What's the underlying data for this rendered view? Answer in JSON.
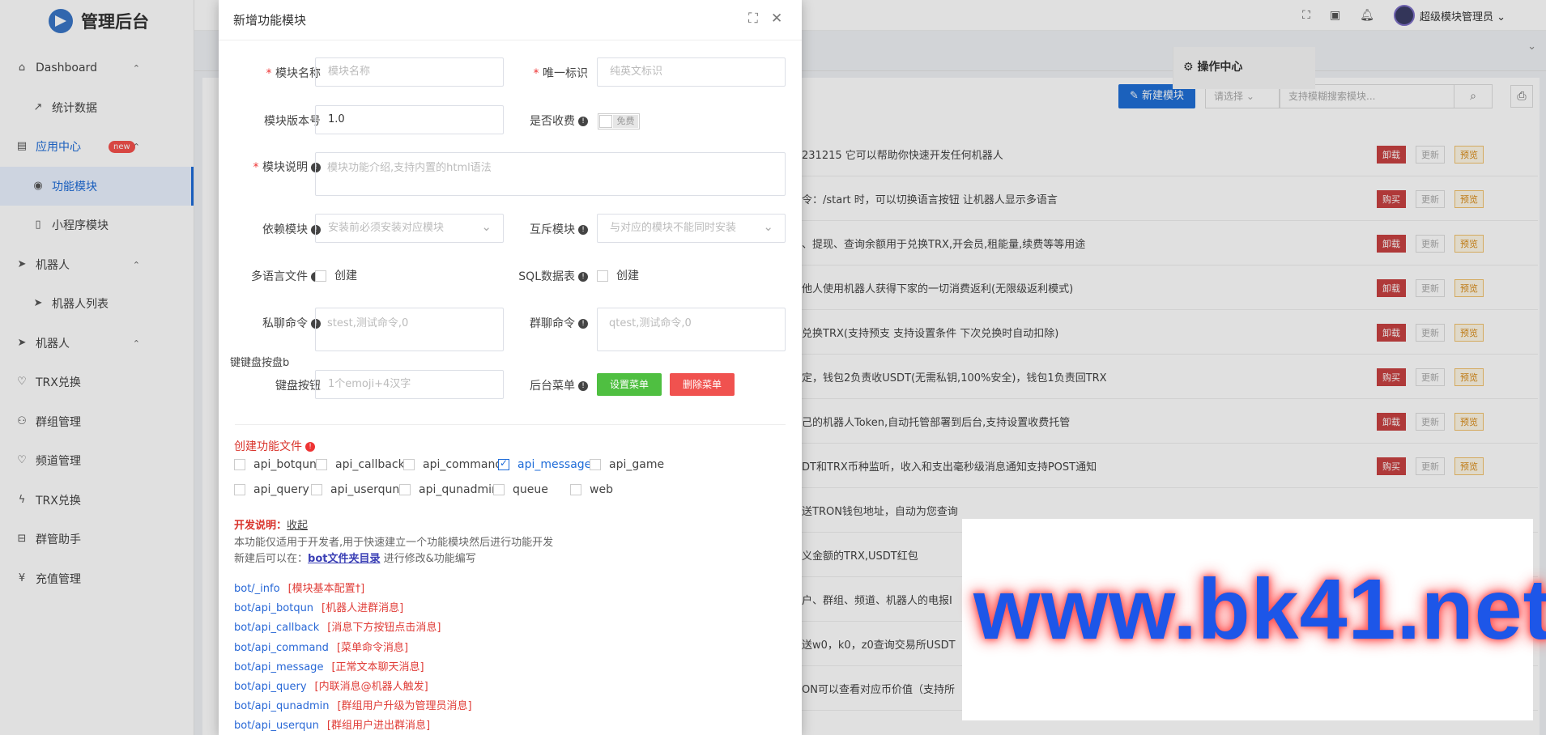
{
  "app": {
    "title": "管理后台"
  },
  "sidebar": {
    "items": [
      {
        "label": "Dashboard",
        "icon": "home-icon",
        "arrow": true
      },
      {
        "label": "统计数据",
        "icon": "trend-icon",
        "sub": true
      },
      {
        "label": "应用中心",
        "icon": "app-center-icon",
        "badge": "new",
        "arrow": true,
        "open": true
      },
      {
        "label": "功能模块",
        "icon": "toggle-icon",
        "sub": true,
        "active": true
      },
      {
        "label": "小程序模块",
        "icon": "doc-icon",
        "sub": true
      },
      {
        "label": "机器人",
        "icon": "send-icon",
        "arrow": true
      },
      {
        "label": "机器人列表",
        "icon": "send-icon",
        "sub": true
      },
      {
        "label": "机器人",
        "icon": "send-icon",
        "arrow": true
      },
      {
        "label": "TRX兑换",
        "icon": "heart-icon"
      },
      {
        "label": "群组管理",
        "icon": "user-icon"
      },
      {
        "label": "频道管理",
        "icon": "heart-icon"
      },
      {
        "label": "TRX兑换",
        "icon": "bolt-icon"
      },
      {
        "label": "群管助手",
        "icon": "tool-icon"
      },
      {
        "label": "充值管理",
        "icon": "yen-icon"
      }
    ]
  },
  "topbar": {
    "user": "超级模块管理员"
  },
  "list": {
    "new_button": "新建模块",
    "select_placeholder": "请选择",
    "search_placeholder": "支持模糊搜索模块...",
    "ops_header": "操作中心",
    "rows": [
      {
        "desc": "231215 它可以帮助你快速开发任何机器人",
        "a": "卸载",
        "b": "更新",
        "c": "预览"
      },
      {
        "desc": "令：/start 时，可以切换语言按钮 让机器人显示多语言",
        "a": "购买",
        "b": "更新",
        "c": "预览"
      },
      {
        "desc": "、提现、查询余额用于兑换TRX,开会员,租能量,续费等等用途",
        "a": "卸载",
        "b": "更新",
        "c": "预览"
      },
      {
        "desc": "他人使用机器人获得下家的一切消费返利(无限级返利模式)",
        "a": "卸载",
        "b": "更新",
        "c": "预览"
      },
      {
        "desc": "兑换TRX(支持预支 支持设置条件 下次兑换时自动扣除)",
        "a": "卸载",
        "b": "更新",
        "c": "预览"
      },
      {
        "desc": "定，钱包2负责收USDT(无需私钥,100%安全)，钱包1负责回TRX",
        "a": "购买",
        "b": "更新",
        "c": "预览"
      },
      {
        "desc": "己的机器人Token,自动托管部署到后台,支持设置收费托管",
        "a": "卸载",
        "b": "更新",
        "c": "预览"
      },
      {
        "desc": "DT和TRX币种监听，收入和支出毫秒级消息通知支持POST通知",
        "a": "购买",
        "b": "更新",
        "c": "预览"
      },
      {
        "desc": "送TRON钱包地址，自动为您查询",
        "a": "",
        "b": "",
        "c": ""
      },
      {
        "desc": "义金额的TRX,USDT红包",
        "a": "",
        "b": "",
        "c": ""
      },
      {
        "desc": "户、群组、频道、机器人的电报I",
        "a": "",
        "b": "",
        "c": ""
      },
      {
        "desc": "送w0，k0，z0查询交易所USDT",
        "a": "",
        "b": "",
        "c": ""
      },
      {
        "desc": "ON可以查看对应币价值（支持所",
        "a": "",
        "b": "",
        "c": ""
      }
    ]
  },
  "modal": {
    "title": "新增功能模块",
    "name_label": "模块名称",
    "name_placeholder": "模块名称",
    "id_label": "唯一标识",
    "id_placeholder": "纯英文标识",
    "version_label": "模块版本号",
    "version_value": "1.0",
    "charge_label": "是否收费",
    "charge_toggle": "免费",
    "desc_label": "模块说明",
    "desc_placeholder": "模块功能介绍,支持内置的html语法",
    "dep_label": "依赖模块",
    "dep_placeholder": "安装前必须安装对应模块",
    "mutex_label": "互斥模块",
    "mutex_placeholder": "与对应的模块不能同时安装",
    "lang_label": "多语言文件",
    "lang_checkbox": "创建",
    "sql_label": "SQL数据表",
    "sql_checkbox": "创建",
    "private_label": "私聊命令",
    "private_placeholder": "stest,测试命令,0",
    "group_label": "群聊命令",
    "group_placeholder": "qtest,测试命令,0",
    "keyboard_caption": "键键盘按盘b",
    "keyboard_label": "键盘按钮",
    "keyboard_placeholder": "1个emoji+4汉字",
    "backend_label": "后台菜单",
    "set_menu": "设置菜单",
    "del_menu": "删除菜单",
    "files_title": "创建功能文件",
    "files": [
      {
        "name": "api_botqun",
        "checked": false
      },
      {
        "name": "api_callback",
        "checked": false
      },
      {
        "name": "api_command",
        "checked": false
      },
      {
        "name": "api_message",
        "checked": true
      },
      {
        "name": "api_game",
        "checked": false
      },
      {
        "name": "api_query",
        "checked": false
      },
      {
        "name": "api_userqun",
        "checked": false
      },
      {
        "name": "api_qunadmin",
        "checked": false
      },
      {
        "name": "queue",
        "checked": false
      },
      {
        "name": "web",
        "checked": false
      }
    ],
    "dev_title": "开发说明：",
    "dev_collapse": "收起",
    "dev_line1": "本功能仅适用于开发者,用于快速建立一个功能模块然后进行功能开发",
    "dev_line2_a": "新建后可以在：",
    "dev_line2_link": "bot文件夹目录",
    "dev_line2_b": " 进行修改&功能编写",
    "api_list": [
      {
        "path": "bot/_info",
        "note": "[模块基本配置†]"
      },
      {
        "path": "bot/api_botqun",
        "note": "[机器人进群消息]"
      },
      {
        "path": "bot/api_callback",
        "note": "[消息下方按钮点击消息]"
      },
      {
        "path": "bot/api_command",
        "note": "[菜单命令消息]"
      },
      {
        "path": "bot/api_message",
        "note": "[正常文本聊天消息]"
      },
      {
        "path": "bot/api_query",
        "note": "[内联消息@机器人触发]"
      },
      {
        "path": "bot/api_qunadmin",
        "note": "[群组用户升级为管理员消息]"
      },
      {
        "path": "bot/api_userqun",
        "note": "[群组用户进出群消息]"
      }
    ]
  },
  "watermark": {
    "text": "www.bk41.net"
  }
}
